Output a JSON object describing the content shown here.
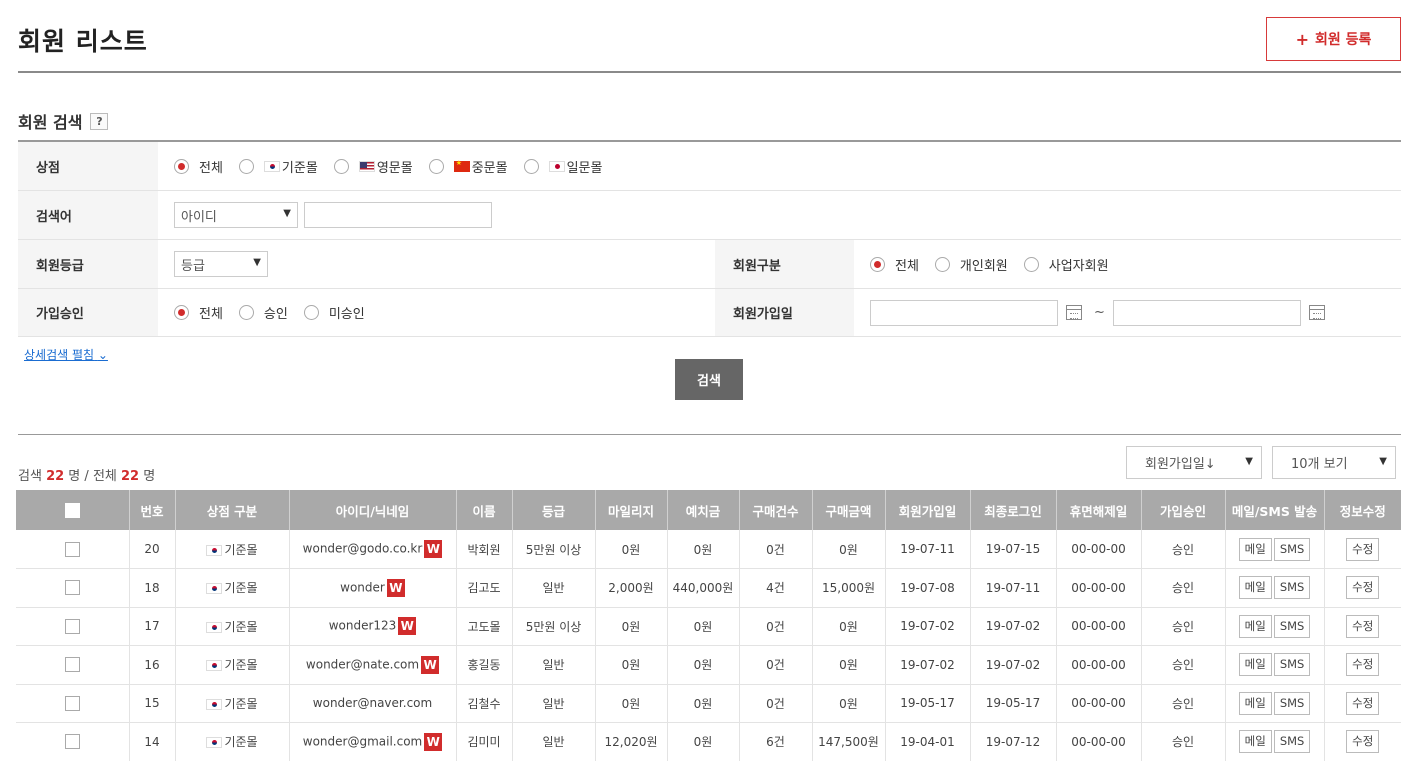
{
  "header": {
    "title": "회원 리스트",
    "register_label": "회원 등록",
    "register_icon": "plus-icon"
  },
  "search": {
    "title": "회원 검색",
    "help": "?",
    "store": {
      "label": "상점",
      "options": [
        "전체",
        "기준몰",
        "영문몰",
        "중문몰",
        "일문몰"
      ],
      "selected": "전체"
    },
    "keyword": {
      "label": "검색어",
      "type_value": "아이디",
      "input_value": ""
    },
    "grade": {
      "label": "회원등급",
      "value": "등급"
    },
    "member_type": {
      "label": "회원구분",
      "options": [
        "전체",
        "개인회원",
        "사업자회원"
      ],
      "selected": "전체"
    },
    "approval": {
      "label": "가입승인",
      "options": [
        "전체",
        "승인",
        "미승인"
      ],
      "selected": "전체"
    },
    "join_date": {
      "label": "회원가입일",
      "from": "",
      "to": "",
      "separator": "~"
    },
    "detail_link": "상세검색 펼침",
    "button": "검색"
  },
  "results": {
    "prefix_search": "검색",
    "search_count": "22",
    "unit": "명",
    "separator": "/",
    "prefix_total": "전체",
    "total_count": "22",
    "sort_value": "회원가입일↓",
    "view_value": "10개 보기"
  },
  "table": {
    "headers": [
      "",
      "번호",
      "상점 구분",
      "아이디/닉네임",
      "이름",
      "등급",
      "마일리지",
      "예치금",
      "구매건수",
      "구매금액",
      "회원가입일",
      "최종로그인",
      "휴면해제일",
      "가입승인",
      "메일/SMS 발송",
      "정보수정"
    ],
    "action_labels": {
      "mail": "메일",
      "sms": "SMS",
      "edit": "수정"
    },
    "badge": "W",
    "rows": [
      {
        "no": "20",
        "store": "기준몰",
        "id": "wonder@godo.co.kr",
        "badge": true,
        "name": "박회원",
        "grade": "5만원 이상",
        "mileage": "0원",
        "deposit": "0원",
        "orders": "0건",
        "amount": "0원",
        "joined": "19-07-11",
        "last_login": "19-07-15",
        "dormant": "00-00-00",
        "approval": "승인"
      },
      {
        "no": "18",
        "store": "기준몰",
        "id": "wonder",
        "badge": true,
        "name": "김고도",
        "grade": "일반",
        "mileage": "2,000원",
        "deposit": "440,000원",
        "orders": "4건",
        "amount": "15,000원",
        "joined": "19-07-08",
        "last_login": "19-07-11",
        "dormant": "00-00-00",
        "approval": "승인"
      },
      {
        "no": "17",
        "store": "기준몰",
        "id": "wonder123",
        "badge": true,
        "name": "고도몰",
        "grade": "5만원 이상",
        "mileage": "0원",
        "deposit": "0원",
        "orders": "0건",
        "amount": "0원",
        "joined": "19-07-02",
        "last_login": "19-07-02",
        "dormant": "00-00-00",
        "approval": "승인"
      },
      {
        "no": "16",
        "store": "기준몰",
        "id": "wonder@nate.com",
        "badge": true,
        "name": "홍길동",
        "grade": "일반",
        "mileage": "0원",
        "deposit": "0원",
        "orders": "0건",
        "amount": "0원",
        "joined": "19-07-02",
        "last_login": "19-07-02",
        "dormant": "00-00-00",
        "approval": "승인"
      },
      {
        "no": "15",
        "store": "기준몰",
        "id": "wonder@naver.com",
        "badge": false,
        "name": "김철수",
        "grade": "일반",
        "mileage": "0원",
        "deposit": "0원",
        "orders": "0건",
        "amount": "0원",
        "joined": "19-05-17",
        "last_login": "19-05-17",
        "dormant": "00-00-00",
        "approval": "승인"
      },
      {
        "no": "14",
        "store": "기준몰",
        "id": "wonder@gmail.com",
        "badge": true,
        "name": "김미미",
        "grade": "일반",
        "mileage": "12,020원",
        "deposit": "0원",
        "orders": "6건",
        "amount": "147,500원",
        "joined": "19-04-01",
        "last_login": "19-07-12",
        "dormant": "00-00-00",
        "approval": "승인"
      }
    ]
  }
}
